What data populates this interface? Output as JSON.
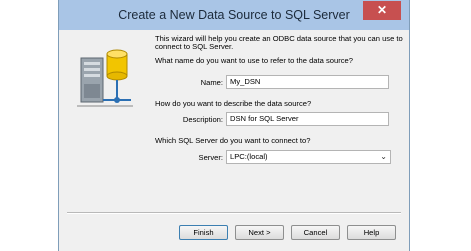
{
  "window": {
    "title": "Create a New Data Source to SQL Server",
    "close_glyph": "✕"
  },
  "wizard": {
    "intro_line1": "This wizard will help you create an ODBC data source that you can use to",
    "intro_line2": "connect to SQL Server.",
    "name_question": "What name do you want to use to refer to the data source?",
    "name_label": "Name:",
    "name_value": "My_DSN",
    "description_question": "How do you want to describe the data source?",
    "description_label": "Description:",
    "description_value": "DSN for SQL Server",
    "server_question": "Which SQL Server do you want to connect to?",
    "server_label": "Server:",
    "server_value": "LPC:(local)"
  },
  "buttons": {
    "finish": "Finish",
    "next": "Next >",
    "cancel": "Cancel",
    "help": "Help"
  },
  "icons": {
    "wizard_art": "odbc-server-database-icon",
    "dropdown": "chevron-down-icon"
  },
  "colors": {
    "titlebar": "#a9c5e6",
    "close": "#c75050",
    "dialog_bg": "#f0f0f0"
  }
}
